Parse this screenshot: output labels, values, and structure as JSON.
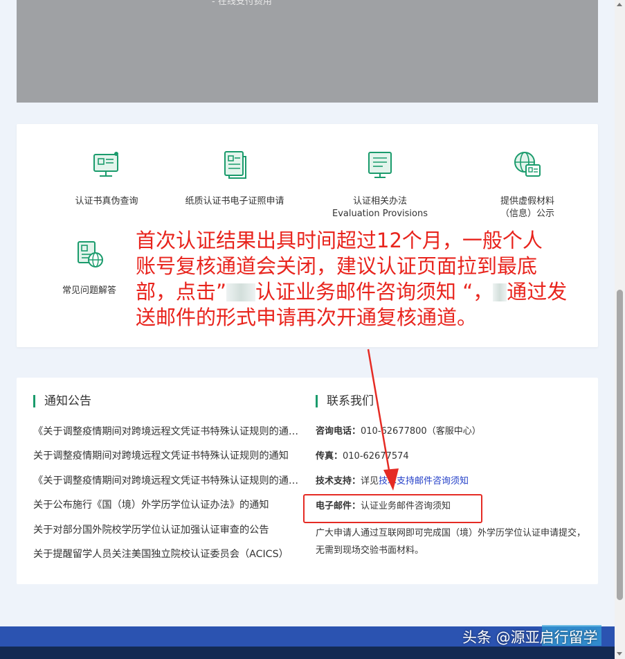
{
  "banner": {
    "text": "- 在线支付费用"
  },
  "services": [
    {
      "label": "认证书真伪查询",
      "icon": "certificate-search-icon"
    },
    {
      "label": "纸质认证书电子证照申请",
      "icon": "document-list-icon"
    },
    {
      "label": "认证相关办法",
      "label2": "Evaluation Provisions",
      "icon": "provisions-document-icon"
    },
    {
      "label": "提供虚假材料",
      "label2": "（信息）公示",
      "icon": "globe-id-icon"
    },
    {
      "label": "常见问题解答",
      "icon": "faq-globe-icon"
    }
  ],
  "overlay_note": {
    "line1": "首次认证结果出具时间超过12个月，一般个人",
    "line2": "账号复核通道会关闭，建议认证页面拉到最底",
    "line3a": "部，点击”",
    "line3b": "认证业务邮件咨询须知 “，",
    "line3c": "通过发",
    "line4": "送邮件的形式申请再次开通复核通道。"
  },
  "notices": {
    "title": "通知公告",
    "items": [
      "《关于调整疫情期间对跨境远程文凭证书特殊认证规则的通知》",
      "关于调整疫情期间对跨境远程文凭证书特殊认证规则的通知",
      "《关于调整疫情期间对跨境远程文凭证书特殊认证规则的通知》",
      "关于公布施行《国（境）外学历学位认证办法》的通知",
      "关于对部分国外院校学历学位认证加强认证审查的公告",
      "关于提醒留学人员关注美国独立院校认证委员会（ACICS）"
    ]
  },
  "contact": {
    "title": "联系我们",
    "phone_label": "咨询电话：",
    "phone_value": "010-62677800（客服中心）",
    "fax_label": "传真：",
    "fax_value": "010-62677574",
    "tech_label": "技术支持：",
    "tech_prefix": "详见",
    "tech_link": "技术支持邮件咨询须知",
    "email_label": "电子邮件：",
    "email_link": "认证业务邮件咨询须知",
    "desc": "广大申请人通过互联网即可完成国（境）外学历学位认证申请提交，无需到现场交验书面材料。"
  },
  "watermark": "头条 @源亚启行留学",
  "colors": {
    "accent": "#1a9b6c",
    "annotation_red": "#e8241d",
    "footer_blue": "#2b53b1"
  }
}
